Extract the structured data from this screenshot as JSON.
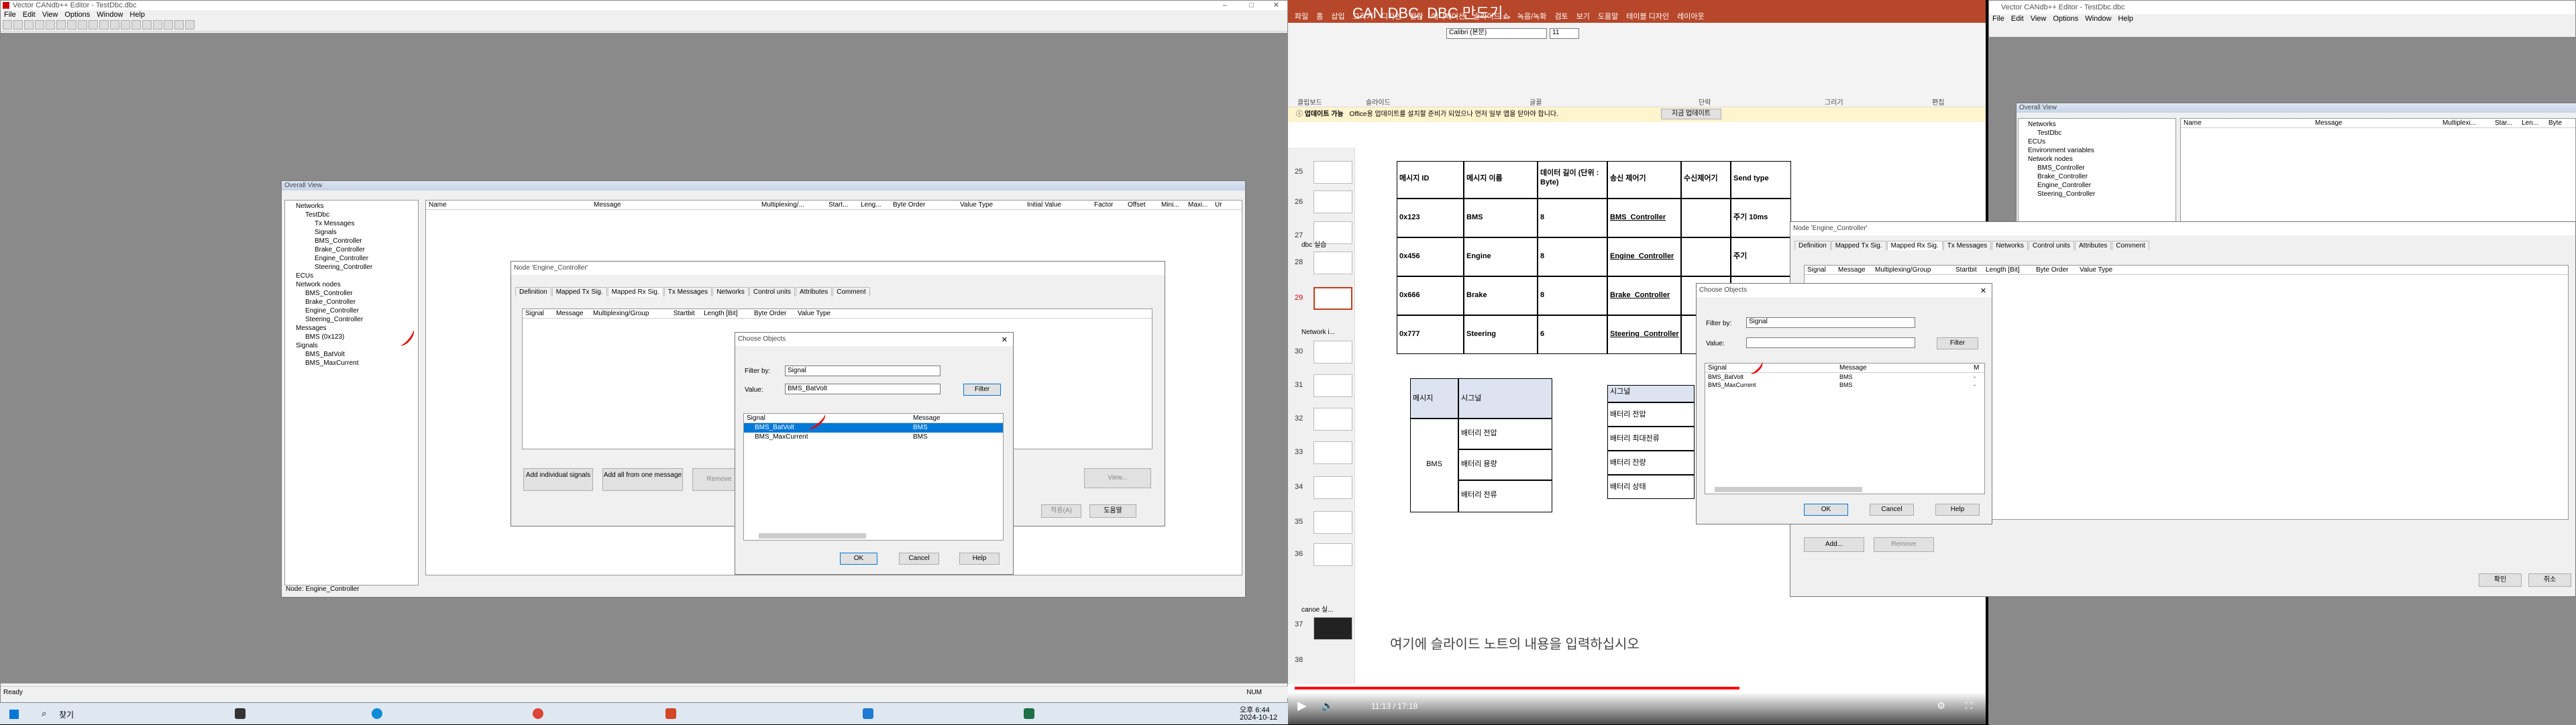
{
  "left": {
    "title": "Vector CANdb++ Editor - TestDbc.dbc",
    "menu": [
      "File",
      "Edit",
      "View",
      "Options",
      "Window",
      "Help"
    ],
    "overall_title": "Overall View",
    "tree": [
      "Networks",
      "TestDbc",
      "Tx Messages",
      "Signals",
      "BMS_Controller",
      "Brake_Controller",
      "Engine_Controller",
      "Steering_Controller",
      "ECUs",
      "Network nodes",
      "BMS_Controller",
      "Brake_Controller",
      "Engine_Controller",
      "Steering_Controller",
      "Messages",
      "BMS (0x123)",
      "Signals",
      "BMS_BatVolt",
      "BMS_MaxCurrent"
    ],
    "columns": [
      "Name",
      "Message",
      "Multiplexing/...",
      "Start...",
      "Leng...",
      "Byte Order",
      "Value Type",
      "Initial Value",
      "Factor",
      "Offset",
      "Mini...",
      "Maxi...",
      "Ur"
    ],
    "status_node": "Node: Engine_Controller",
    "status": "Ready",
    "num": "NUM",
    "node_title": "Node 'Engine_Controller'",
    "node_tabs": [
      "Definition",
      "Mapped Tx Sig.",
      "Mapped Rx Sig.",
      "Tx Messages",
      "Networks",
      "Control units",
      "Attributes",
      "Comment"
    ],
    "node_cols": [
      "Signal",
      "Message",
      "Multiplexing/Group",
      "Startbit",
      "Length [Bit]",
      "Byte Order",
      "Value Type"
    ],
    "node_btns": [
      "Add individual signals",
      "Add all from one message",
      "Remove",
      "View..."
    ],
    "node_bottom_btns": [
      "확인",
      "적용(A)",
      "도움말"
    ],
    "choose": {
      "title": "Choose Objects",
      "filter_label": "Filter by:",
      "filter": "Signal",
      "value_label": "Value:",
      "value": "BMS_BatVolt",
      "filter_btn": "Filter",
      "col_signal": "Signal",
      "col_message": "Message",
      "rows": [
        {
          "s": "BMS_BatVolt",
          "m": "BMS"
        },
        {
          "s": "BMS_MaxCurrent",
          "m": "BMS"
        }
      ],
      "ok": "OK",
      "cancel": "Cancel",
      "help": "Help"
    }
  },
  "taskbar": {
    "search": "찾기",
    "time": "오후 6:44",
    "date": "2024-10-12"
  },
  "ppt": {
    "title": "CAN DBC, DBC 만드기..",
    "tabs": [
      "파일",
      "홈",
      "삽입",
      "그리기",
      "디자인",
      "전환",
      "애니메이션",
      "슬라이드 쇼",
      "녹음/녹화",
      "검토",
      "보기",
      "도움말",
      "테이블 디자인",
      "레이아웃"
    ],
    "font": "Calibri (본문)",
    "size": "11",
    "groups": [
      "클립보드",
      "슬라이드",
      "글꼴",
      "단락",
      "그리기",
      "편집"
    ],
    "update": "업데이트 가능",
    "update_msg": "Office용 업데이트를 설치할 준비가 되었으나 먼저 일부 앱을 닫아야 합니다.",
    "update_btn": "지금 업데이트",
    "slide_nums": [
      "25",
      "26",
      "27",
      "28",
      "29",
      "30",
      "31",
      "32",
      "33",
      "34",
      "35",
      "36",
      "37",
      "38"
    ],
    "sections": [
      "dbc 실습",
      "Network i...",
      "canoe 실..."
    ],
    "table1": {
      "hdr": [
        "메시지 ID",
        "메시지 이름",
        "데이터 길이 (단위 : Byte)",
        "송신 제어기",
        "수신제어기",
        "Send type"
      ],
      "rows": [
        [
          "0x123",
          "BMS",
          "8",
          "BMS_Controller",
          "",
          "주기 10ms"
        ],
        [
          "0x456",
          "Engine",
          "8",
          "Engine_Controller",
          "",
          "주기"
        ],
        [
          "0x666",
          "Brake",
          "8",
          "Brake_Controller",
          "",
          ""
        ],
        [
          "0x777",
          "Steering",
          "6",
          "Steering_Controller",
          "",
          ""
        ]
      ]
    },
    "table2": {
      "c1": "메시지",
      "c2": "시그널",
      "msg": "BMS",
      "sigs": [
        "배터리 전압",
        "배터리 용량",
        "배터리 전류"
      ]
    },
    "table3": {
      "hdr": "시그널",
      "rows": [
        "배터리 전압",
        "배터리 최대전류",
        "배터리 잔량",
        "배터리 상태"
      ]
    },
    "notes": "여기에 슬라이드 노트의 내용을 입력하십시오",
    "video_time": "11:13 / 17:18"
  },
  "right": {
    "title": "Vector CANdb++ Editor - TestDbc.dbc",
    "menu": [
      "File",
      "Edit",
      "View",
      "Options",
      "Window",
      "Help"
    ],
    "overall_title": "Overall View",
    "tree": [
      "Networks",
      "TestDbc",
      "ECUs",
      "Environment variables",
      "Network nodes",
      "BMS_Controller",
      "Brake_Controller",
      "Engine_Controller",
      "Steering_Controller"
    ],
    "columns": [
      "Name",
      "Message",
      "Multiplexi...",
      "Star...",
      "Len...",
      "Byte"
    ],
    "node_title": "Node 'Engine_Controller'",
    "node_tabs": [
      "Definition",
      "Mapped Tx Sig.",
      "Mapped Rx Sig.",
      "Tx Messages",
      "Networks",
      "Control units",
      "Attributes",
      "Comment"
    ],
    "node_cols": [
      "Signal",
      "Message",
      "Multiplexing/Group",
      "Startbit",
      "Length [Bit]",
      "Byte Order",
      "Value Type"
    ],
    "add_btn": "Add...",
    "remove_btn": "Remove",
    "choose": {
      "title": "Choose Objects",
      "filter_label": "Filter by:",
      "filter": "Signal",
      "value_label": "Value:",
      "value": "",
      "filter_btn": "Filter",
      "col_signal": "Signal",
      "col_message": "Message",
      "col_m": "M",
      "rows": [
        {
          "s": "BMS_BatVolt",
          "m": "BMS",
          "x": "-"
        },
        {
          "s": "BMS_MaxCurrent",
          "m": "BMS",
          "x": "-"
        }
      ],
      "ok": "OK",
      "cancel": "Cancel",
      "help": "Help"
    },
    "bottom_btns": [
      "확인",
      "취소"
    ]
  }
}
